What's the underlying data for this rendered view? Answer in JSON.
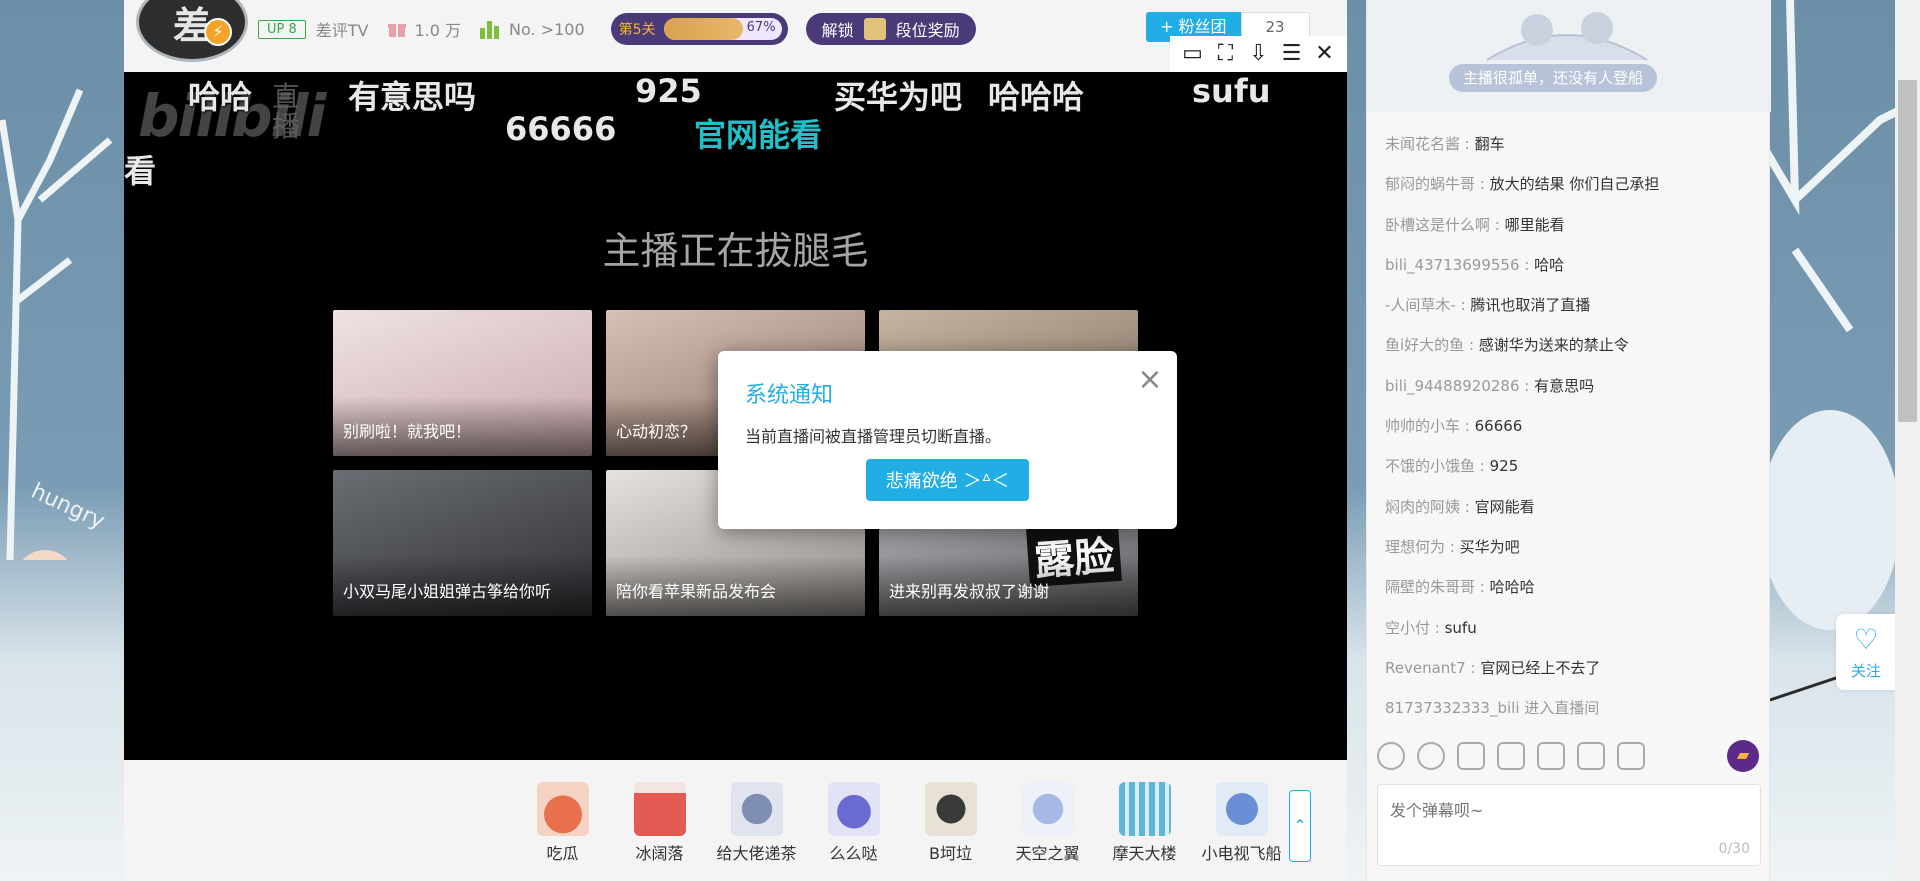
{
  "header": {
    "avatar_text": "差",
    "up_level": "UP 8",
    "channel_name": "差评TV",
    "gift_count": "1.0 万",
    "rank": "No. >100",
    "level_label": "第5关",
    "level_progress": "67%",
    "level_progress_fraction": 0.67,
    "unlock_label": "解锁",
    "reward_label": "段位奖励",
    "fan_join_label": "+ 粉丝团",
    "fan_count": "23"
  },
  "player_toolbar": {
    "icons": [
      "video-icon",
      "fullscreen-icon",
      "download-icon",
      "menu-icon",
      "close-icon"
    ],
    "glyphs": [
      "▭",
      "⛶",
      "⇩",
      "☰",
      "✕"
    ]
  },
  "video": {
    "logo_text": "bilibili",
    "live_text": "直播",
    "danmaku": [
      {
        "text": "哈哈",
        "highlight": false
      },
      {
        "text": "有意思吗",
        "highlight": false
      },
      {
        "text": "925",
        "highlight": false
      },
      {
        "text": "买华为吧",
        "highlight": false
      },
      {
        "text": "哈哈哈",
        "highlight": false
      },
      {
        "text": "sufu",
        "highlight": false
      },
      {
        "text": "66666",
        "highlight": false
      },
      {
        "text": "官网能看",
        "highlight": true
      },
      {
        "text": "看",
        "highlight": false
      }
    ],
    "offline_title": "主播正在拔腿毛",
    "recommendations": [
      {
        "title": "别刷啦！就我吧！",
        "color": "#d9c3c6"
      },
      {
        "title": "心动初恋？",
        "color": "#b69b8e"
      },
      {
        "title": "",
        "color": "#9c8d7c"
      },
      {
        "title": "小双马尾小姐姐弹古筝给你听",
        "color": "#4c4e52"
      },
      {
        "title": "陪你看苹果新品发布会",
        "color": "#c8c3bf"
      },
      {
        "title": "进来别再发叔叔了谢谢",
        "color": "#9a9b9e",
        "badge": "露脸"
      }
    ]
  },
  "modal": {
    "title": "系统通知",
    "message": "当前直播间被直播管理员切断直播。",
    "button_label": "悲痛欲绝 ＞ᐞ＜"
  },
  "gifts": [
    {
      "name": "吃瓜",
      "color": "#e8704d"
    },
    {
      "name": "冰阔落",
      "color": "#e25b52"
    },
    {
      "name": "给大佬递茶",
      "color": "#7f8fb3"
    },
    {
      "name": "么么哒",
      "color": "#6a6ad3"
    },
    {
      "name": "B坷垃",
      "color": "#3a3a3a"
    },
    {
      "name": "天空之翼",
      "color": "#a6b8e6"
    },
    {
      "name": "摩天大楼",
      "color": "#5fb6d7"
    },
    {
      "name": "小电视飞船",
      "color": "#6b8fd6"
    }
  ],
  "gift_more_glyph": "⌃",
  "chat": {
    "banner_tip": "主播很孤单，还没有人登船",
    "messages": [
      {
        "user": "未闻花名酱",
        "msg": "翻车"
      },
      {
        "user": "郁闷的蜗牛哥",
        "msg": "放大的结果 你们自己承担"
      },
      {
        "user": "卧槽这是什么啊",
        "msg": "哪里能看"
      },
      {
        "user": "bili_43713699556",
        "msg": "哈哈"
      },
      {
        "user": "-人间草木-",
        "msg": "腾讯也取消了直播"
      },
      {
        "user": "鱼i好大的鱼",
        "msg": "感谢华为送来的禁止令"
      },
      {
        "user": "bili_94488920286",
        "msg": "有意思吗"
      },
      {
        "user": "帅帅的小车",
        "msg": "66666"
      },
      {
        "user": "不饿的小饿鱼",
        "msg": "925"
      },
      {
        "user": "焖肉的阿姨",
        "msg": "官网能看"
      },
      {
        "user": "理想何为",
        "msg": "买华为吧"
      },
      {
        "user": "隔壁的朱哥哥",
        "msg": "哈哈哈"
      },
      {
        "user": "空小付",
        "msg": "sufu"
      },
      {
        "user": "Revenant7",
        "msg": "官网已经上不去了"
      },
      {
        "user": "81737332333_bili",
        "msg": "进入直播间",
        "system": true
      }
    ],
    "input_placeholder": "发个弹幕呗~",
    "input_counter": "0/30"
  },
  "follow": {
    "label": "关注"
  },
  "colors": {
    "accent": "#23ade5",
    "purple": "#4a3a78",
    "highlight_danmaku": "#1fc0c7"
  }
}
